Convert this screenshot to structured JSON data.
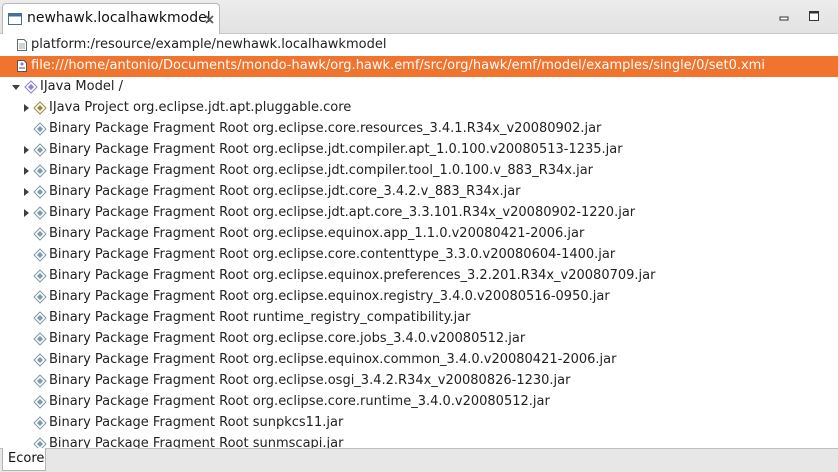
{
  "editor_tab": {
    "title": "newhawk.localhawkmodel"
  },
  "tree": {
    "resource_row": {
      "label": "platform:/resource/example/newhawk.localhawkmodel"
    },
    "file_row": {
      "label": "file:///home/antonio/Documents/mondo-hawk/org.hawk.emf/src/org/hawk/emf/model/examples/single/0/set0.xmi"
    },
    "model_row": {
      "label": "IJava Model /"
    },
    "project_row": {
      "label": "IJava Project org.eclipse.jdt.apt.pluggable.core"
    },
    "fragments": [
      {
        "label": "Binary Package Fragment Root org.eclipse.core.resources_3.4.1.R34x_v20080902.jar",
        "expandable": false
      },
      {
        "label": "Binary Package Fragment Root org.eclipse.jdt.compiler.apt_1.0.100.v20080513-1235.jar",
        "expandable": true
      },
      {
        "label": "Binary Package Fragment Root org.eclipse.jdt.compiler.tool_1.0.100.v_883_R34x.jar",
        "expandable": true
      },
      {
        "label": "Binary Package Fragment Root org.eclipse.jdt.core_3.4.2.v_883_R34x.jar",
        "expandable": true
      },
      {
        "label": "Binary Package Fragment Root org.eclipse.jdt.apt.core_3.3.101.R34x_v20080902-1220.jar",
        "expandable": true
      },
      {
        "label": "Binary Package Fragment Root org.eclipse.equinox.app_1.1.0.v20080421-2006.jar",
        "expandable": false
      },
      {
        "label": "Binary Package Fragment Root org.eclipse.core.contenttype_3.3.0.v20080604-1400.jar",
        "expandable": false
      },
      {
        "label": "Binary Package Fragment Root org.eclipse.equinox.preferences_3.2.201.R34x_v20080709.jar",
        "expandable": false
      },
      {
        "label": "Binary Package Fragment Root org.eclipse.equinox.registry_3.4.0.v20080516-0950.jar",
        "expandable": false
      },
      {
        "label": "Binary Package Fragment Root runtime_registry_compatibility.jar",
        "expandable": false
      },
      {
        "label": "Binary Package Fragment Root org.eclipse.core.jobs_3.4.0.v20080512.jar",
        "expandable": false
      },
      {
        "label": "Binary Package Fragment Root org.eclipse.equinox.common_3.4.0.v20080421-2006.jar",
        "expandable": false
      },
      {
        "label": "Binary Package Fragment Root org.eclipse.osgi_3.4.2.R34x_v20080826-1230.jar",
        "expandable": false
      },
      {
        "label": "Binary Package Fragment Root org.eclipse.core.runtime_3.4.0.v20080512.jar",
        "expandable": false
      },
      {
        "label": "Binary Package Fragment Root sunpkcs11.jar",
        "expandable": false
      },
      {
        "label": "Binary Package Fragment Root sunmscapi.jar",
        "expandable": false
      }
    ]
  },
  "bottom_tab": {
    "label": "Ecore"
  },
  "icons": {
    "tab": "model-editor-icon",
    "close": "close-icon",
    "minimize": "minimize-icon",
    "maximize": "maximize-icon",
    "resource": "resource-file-icon",
    "file": "xmi-file-icon",
    "model": "model-object-icon",
    "project": "model-object-icon",
    "fragment": "model-object-icon"
  },
  "colors": {
    "selection": "#f0732e",
    "icon_diamond": "#8c7fd1",
    "icon_fragment": "#7a9aa8",
    "project_icon": "#9a8a3c"
  }
}
